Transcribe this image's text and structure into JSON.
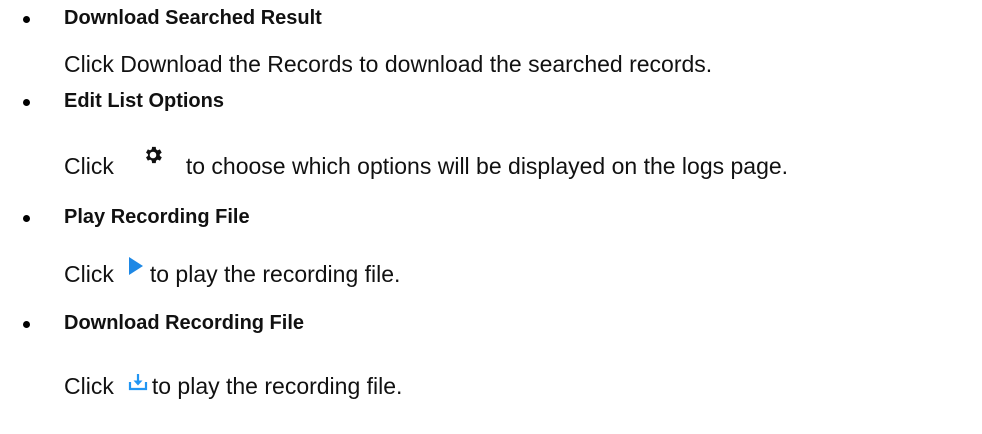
{
  "items": [
    {
      "title": "Download Searched Result",
      "description": "Click Download the Records to download the searched records."
    },
    {
      "title": "Edit List Options",
      "before_icon": "Click",
      "icon": "gear-icon",
      "after_icon": "to choose which options will be displayed on the logs page."
    },
    {
      "title": "Play Recording File",
      "before_icon": "Click",
      "icon": "play-icon",
      "after_icon": "to play the recording file."
    },
    {
      "title": "Download Recording File",
      "before_icon": "Click",
      "icon": "download-icon",
      "after_icon": "to play the recording file."
    }
  ],
  "colors": {
    "text": "#111111",
    "bullet": "#000000",
    "play_icon": "#1e88e5",
    "download_icon": "#2196f3",
    "gear_icon": "#111111"
  }
}
